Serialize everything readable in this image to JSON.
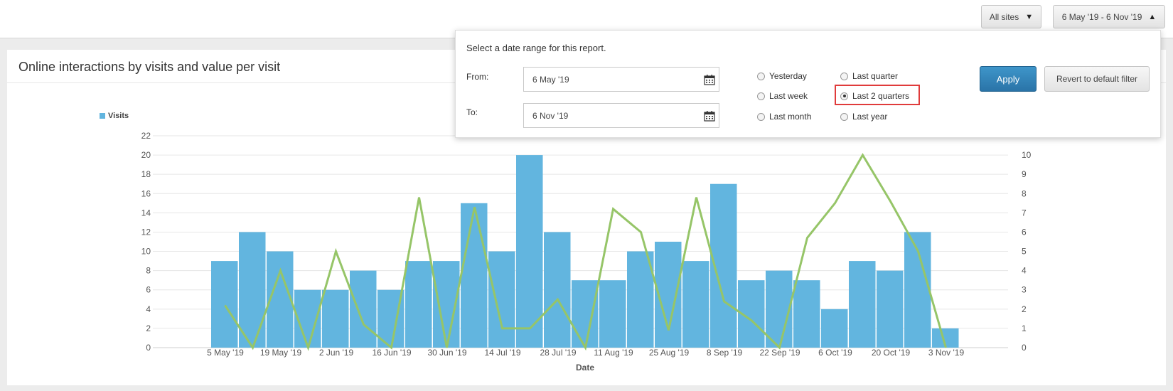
{
  "toolbar": {
    "sites_label": "All sites",
    "range_label": "6 May '19 - 6 Nov '19"
  },
  "panel": {
    "title": "Online interactions by visits and value per visit"
  },
  "date_popup": {
    "prompt": "Select a date range for this report.",
    "from_label": "From:",
    "from_value": "6 May '19",
    "to_label": "To:",
    "to_value": "6 Nov '19",
    "options": [
      {
        "label": "Yesterday",
        "selected": false
      },
      {
        "label": "Last week",
        "selected": false
      },
      {
        "label": "Last month",
        "selected": false
      },
      {
        "label": "Last quarter",
        "selected": false
      },
      {
        "label": "Last 2 quarters",
        "selected": true
      },
      {
        "label": "Last year",
        "selected": false
      }
    ],
    "apply_label": "Apply",
    "revert_label": "Revert to default filter"
  },
  "chart_data": {
    "type": "bar",
    "xlabel": "Date",
    "legend": [
      "Visits"
    ],
    "x_tick_labels": [
      "5 May '19",
      "19 May '19",
      "2 Jun '19",
      "16 Jun '19",
      "30 Jun '19",
      "14 Jul '19",
      "28 Jul '19",
      "11 Aug '19",
      "25 Aug '19",
      "8 Sep '19",
      "22 Sep '19",
      "6 Oct '19",
      "20 Oct '19",
      "3 Nov '19"
    ],
    "y_left_ticks": [
      0,
      2,
      4,
      6,
      8,
      10,
      12,
      14,
      16,
      18,
      20,
      22
    ],
    "y_right_ticks": [
      0,
      1,
      2,
      3,
      4,
      5,
      6,
      7,
      8,
      9,
      10
    ],
    "ylim_left": [
      0,
      22
    ],
    "ylim_right": [
      0,
      11
    ],
    "grid": true,
    "legend_position": "top-left",
    "series": [
      {
        "name": "Visits",
        "type": "bar",
        "axis": "left",
        "color": "#62b5df",
        "values": [
          9,
          12,
          10,
          6,
          6,
          8,
          6,
          9,
          9,
          15,
          10,
          20,
          12,
          7,
          7,
          10,
          11,
          9,
          17,
          7,
          8,
          7,
          4,
          9,
          8,
          12,
          2
        ]
      },
      {
        "type": "line",
        "axis": "right",
        "color": "#96c568",
        "values": [
          2.2,
          0,
          4,
          0,
          5,
          1.2,
          0,
          7.8,
          0,
          7.3,
          1,
          1,
          2.5,
          0,
          7.2,
          6,
          0.9,
          7.8,
          2.4,
          1.4,
          0,
          5.7,
          7.5,
          10,
          7.6,
          5,
          0
        ]
      }
    ]
  }
}
